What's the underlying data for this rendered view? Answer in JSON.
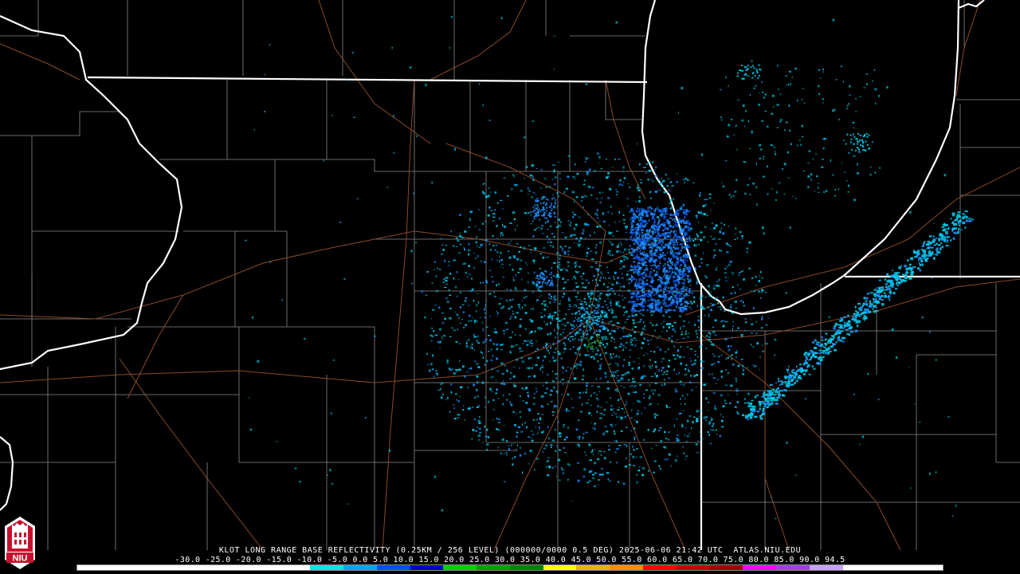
{
  "product": {
    "title": "KLOT LONG RANGE BASE REFLECTIVITY (0.25KM / 256 LEVEL) (000000/0000 0.5 DEG) 2025-06-06 21:42 UTC  ATLAS.NIU.EDU",
    "radar_site": "KLOT",
    "valid_time": "2025-06-06 21:42 UTC",
    "elevation": "0.5 DEG",
    "source": "ATLAS.NIU.EDU"
  },
  "scale": {
    "labels": [
      "-30.0",
      "-25.0",
      "-20.0",
      "-15.0",
      "-10.0",
      "-5.0",
      "0.0",
      "5.0",
      "10.0",
      "15.0",
      "20.0",
      "25.0",
      "30.0",
      "35.0",
      "40.0",
      "45.0",
      "50.0",
      "55.0",
      "60.0",
      "65.0",
      "70.0",
      "75.0",
      "80.0",
      "85.0",
      "90.0",
      "94.5"
    ],
    "colors": [
      "#ffffff",
      "#ffffff",
      "#ffffff",
      "#ffffff",
      "#ffffff",
      "#ffffff",
      "#ffffff",
      "#00e5e5",
      "#00a8e8",
      "#0050f0",
      "#0000c8",
      "#00d000",
      "#00a000",
      "#008000",
      "#ffff00",
      "#e6b400",
      "#ff8c00",
      "#ff0000",
      "#c80000",
      "#a00000",
      "#ff00ff",
      "#a040e0",
      "#c8a0ff",
      "#ffffff",
      "#ffffff",
      "#ffffff"
    ]
  },
  "logo": {
    "text": "NIU",
    "color": "#c8102e"
  },
  "map_colors": {
    "state_border": "#ffffff",
    "county_border": "#8a8a8a",
    "highway": "#8b4a2a",
    "echo_light": "#00c8e8",
    "echo_medium": "#1e8cff",
    "echo_strong": "#0a50e0",
    "echo_green": "#20c020"
  }
}
